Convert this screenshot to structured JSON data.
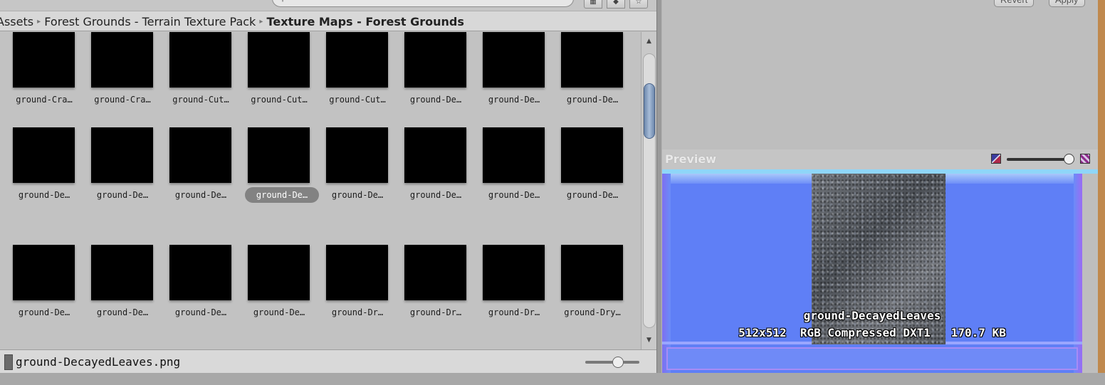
{
  "breadcrumb": {
    "items": [
      "Assets",
      "Forest Grounds - Terrain Texture Pack",
      "Texture Maps - Forest Grounds"
    ],
    "separator": "▸"
  },
  "toolbar": {
    "search_icon": "search-icon",
    "buttons": [
      "filter-by-type-icon",
      "favorites-icon",
      "star-icon"
    ]
  },
  "grid": {
    "rows": [
      [
        "ground-Cra…",
        "ground-Cra…",
        "ground-Cut…",
        "ground-Cut…",
        "ground-Cut…",
        "ground-De…",
        "ground-De…",
        "ground-De…"
      ],
      [
        "ground-De…",
        "ground-De…",
        "ground-De…",
        "ground-De…",
        "ground-De…",
        "ground-De…",
        "ground-De…",
        "ground-De…"
      ],
      [
        "ground-De…",
        "ground-De…",
        "ground-De…",
        "ground-De…",
        "ground-Dr…",
        "ground-Dr…",
        "ground-Dr…",
        "ground-Dry…"
      ]
    ],
    "selected": {
      "row": 1,
      "col": 3
    }
  },
  "status": {
    "filename": "ground-DecayedLeaves.png"
  },
  "inspector": {
    "revert_label": "Revert",
    "apply_label": "Apply"
  },
  "preview": {
    "title": "Preview",
    "asset_name": "ground-DecayedLeaves",
    "info": "512x512  RGB Compressed DXT1   170.7 KB",
    "colors": {
      "normal_map_blue": "#5f7ff6",
      "texture_gray": "#5f6368"
    }
  }
}
